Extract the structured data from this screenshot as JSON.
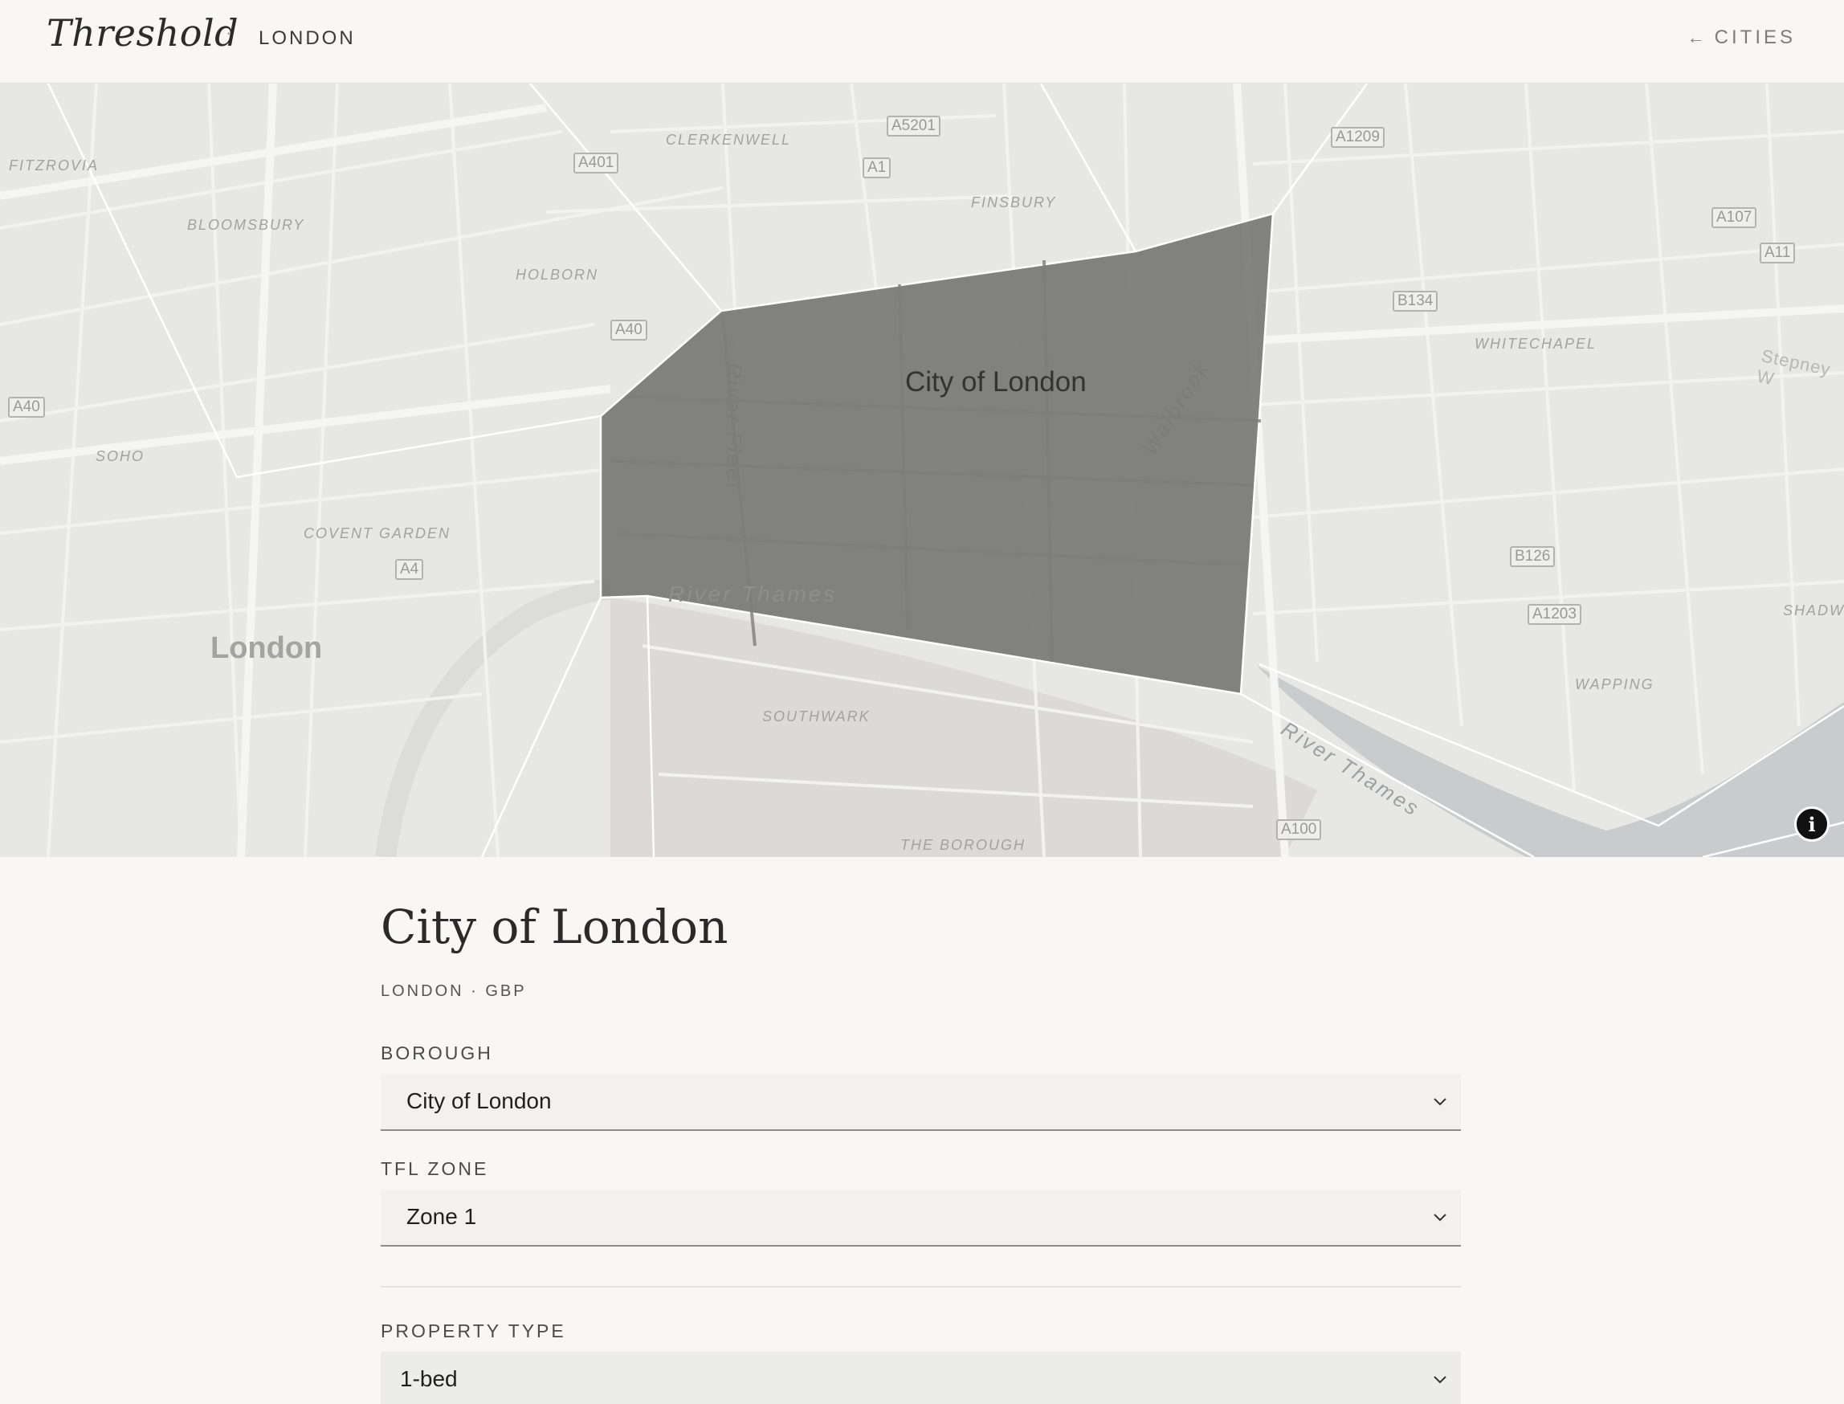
{
  "header": {
    "brand": "Threshold",
    "separator": "·",
    "city": "LONDON",
    "back_arrow": "←",
    "back_label": "CITIES"
  },
  "map": {
    "selected_area_label": "City of London",
    "city_label": "London",
    "area_labels": [
      "FITZROVIA",
      "BLOOMSBURY",
      "HOLBORN",
      "CLERKENWELL",
      "FINSBURY",
      "SOHO",
      "COVENT GARDEN",
      "SOUTHWARK",
      "THE BOROUGH",
      "WHITECHAPEL",
      "WAPPING",
      "SHADW",
      "Stepney W"
    ],
    "road_labels": [
      "A401",
      "A5201",
      "A1",
      "A1209",
      "A107",
      "A11",
      "A40",
      "A40",
      "B134",
      "A4",
      "B126",
      "A1203",
      "A100"
    ],
    "water_labels": [
      "River Thames",
      "River Thames"
    ],
    "street_labels": [
      "River Fleet",
      "Walbrook"
    ],
    "info_icon": "i",
    "colors": {
      "selected_fill": "#6e6e6c",
      "land": "#e7e7e3",
      "water": "#c9cbcc"
    }
  },
  "details": {
    "title": "City of London",
    "subtitle": "LONDON · GBP",
    "borough_label": "BOROUGH",
    "borough_value": "City of London",
    "zone_label": "TFL ZONE",
    "zone_value": "Zone 1",
    "property_label": "PROPERTY TYPE",
    "property_value": "1-bed"
  }
}
